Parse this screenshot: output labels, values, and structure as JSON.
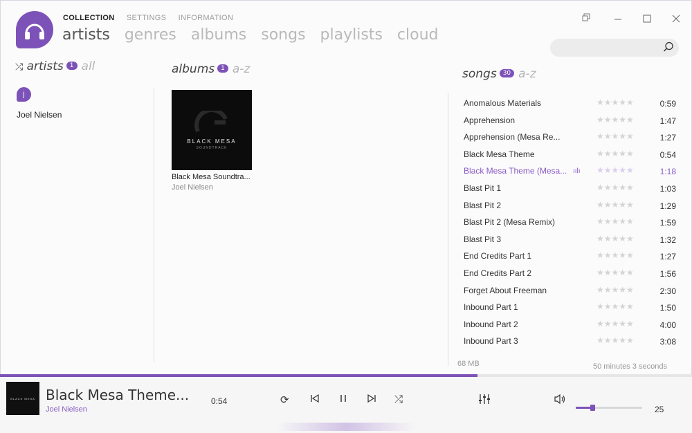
{
  "top_nav": [
    "COLLECTION",
    "SETTINGS",
    "INFORMATION"
  ],
  "main_nav": [
    "artists",
    "genres",
    "albums",
    "songs",
    "playlists",
    "cloud"
  ],
  "search": {
    "placeholder": "",
    "value": ""
  },
  "artists_panel": {
    "header": "artists",
    "count": "1",
    "sort": "all",
    "letter": "j",
    "items": [
      "Joel Nielsen"
    ]
  },
  "albums_panel": {
    "header": "albums",
    "count": "1",
    "sort": "a-z",
    "cover_text": "BLACK MESA",
    "cover_subtext": "SOUNDTRACK",
    "album_title": "Black Mesa Soundtra...",
    "album_artist": "Joel Nielsen"
  },
  "songs_panel": {
    "header": "songs",
    "count": "30",
    "sort": "a-z",
    "songs": [
      {
        "title": "Anomalous Materials",
        "duration": "0:59",
        "rating": 0
      },
      {
        "title": "Apprehension",
        "duration": "1:47",
        "rating": 0
      },
      {
        "title": "Apprehension (Mesa Re...",
        "duration": "1:27",
        "rating": 0
      },
      {
        "title": "Black Mesa Theme",
        "duration": "0:54",
        "rating": 0
      },
      {
        "title": "Black Mesa Theme (Mesa...",
        "duration": "1:18",
        "rating": 0,
        "playing": true
      },
      {
        "title": "Blast Pit 1",
        "duration": "1:03",
        "rating": 0
      },
      {
        "title": "Blast Pit 2",
        "duration": "1:29",
        "rating": 0
      },
      {
        "title": "Blast Pit 2 (Mesa Remix)",
        "duration": "1:59",
        "rating": 0
      },
      {
        "title": "Blast Pit 3",
        "duration": "1:32",
        "rating": 0
      },
      {
        "title": "End Credits Part 1",
        "duration": "1:27",
        "rating": 0
      },
      {
        "title": "End Credits Part 2",
        "duration": "1:56",
        "rating": 0
      },
      {
        "title": "Forget About Freeman",
        "duration": "2:30",
        "rating": 0
      },
      {
        "title": "Inbound Part 1",
        "duration": "1:50",
        "rating": 0
      },
      {
        "title": "Inbound Part 2",
        "duration": "4:00",
        "rating": 0
      },
      {
        "title": "Inbound Part 3",
        "duration": "3:08",
        "rating": 0
      }
    ],
    "footer_size": "68 MB",
    "footer_time": "50 minutes 3 seconds"
  },
  "now_playing": {
    "title": "Black Mesa Theme...",
    "artist": "Joel Nielsen",
    "position": "0:54",
    "progress_fraction": 0.69
  },
  "volume": {
    "value": "25",
    "level": 0.25
  },
  "colors": {
    "accent": "#7d52b8",
    "playing_text": "#8a5cc4"
  },
  "icons": [
    "shuffle-icon",
    "search-icon",
    "restore-icon",
    "minimize-icon",
    "maximize-icon",
    "close-icon",
    "repeat-icon",
    "previous-icon",
    "pause-icon",
    "next-icon",
    "equalizer-icon",
    "volume-icon"
  ]
}
